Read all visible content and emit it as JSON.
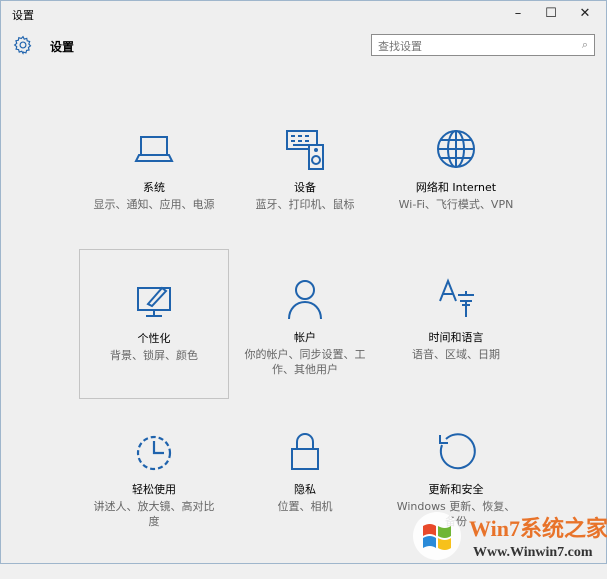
{
  "window": {
    "title": "设置",
    "minimize": "–",
    "maximize": "☐",
    "close": "✕"
  },
  "header": {
    "title": "设置",
    "search_placeholder": "查找设置",
    "search_icon": "⌕"
  },
  "tiles": [
    {
      "name": "系统",
      "desc": "显示、通知、应用、电源",
      "icon": "laptop-icon"
    },
    {
      "name": "设备",
      "desc": "蓝牙、打印机、鼠标",
      "icon": "devices-icon"
    },
    {
      "name": "网络和 Internet",
      "desc": "Wi-Fi、飞行模式、VPN",
      "icon": "globe-icon"
    },
    {
      "name": "个性化",
      "desc": "背景、锁屏、颜色",
      "icon": "personalization-icon"
    },
    {
      "name": "帐户",
      "desc": "你的帐户、同步设置、工作、其他用户",
      "icon": "person-icon"
    },
    {
      "name": "时间和语言",
      "desc": "语音、区域、日期",
      "icon": "time-language-icon"
    },
    {
      "name": "轻松使用",
      "desc": "讲述人、放大镜、高对比度",
      "icon": "ease-of-access-icon"
    },
    {
      "name": "隐私",
      "desc": "位置、相机",
      "icon": "lock-icon"
    },
    {
      "name": "更新和安全",
      "desc": "Windows 更新、恢复、备份",
      "icon": "update-icon"
    }
  ],
  "watermark": {
    "brand": "Win7系统之家",
    "url": "Www.Winwin7.com"
  },
  "colors": {
    "accent": "#1f63ad"
  }
}
